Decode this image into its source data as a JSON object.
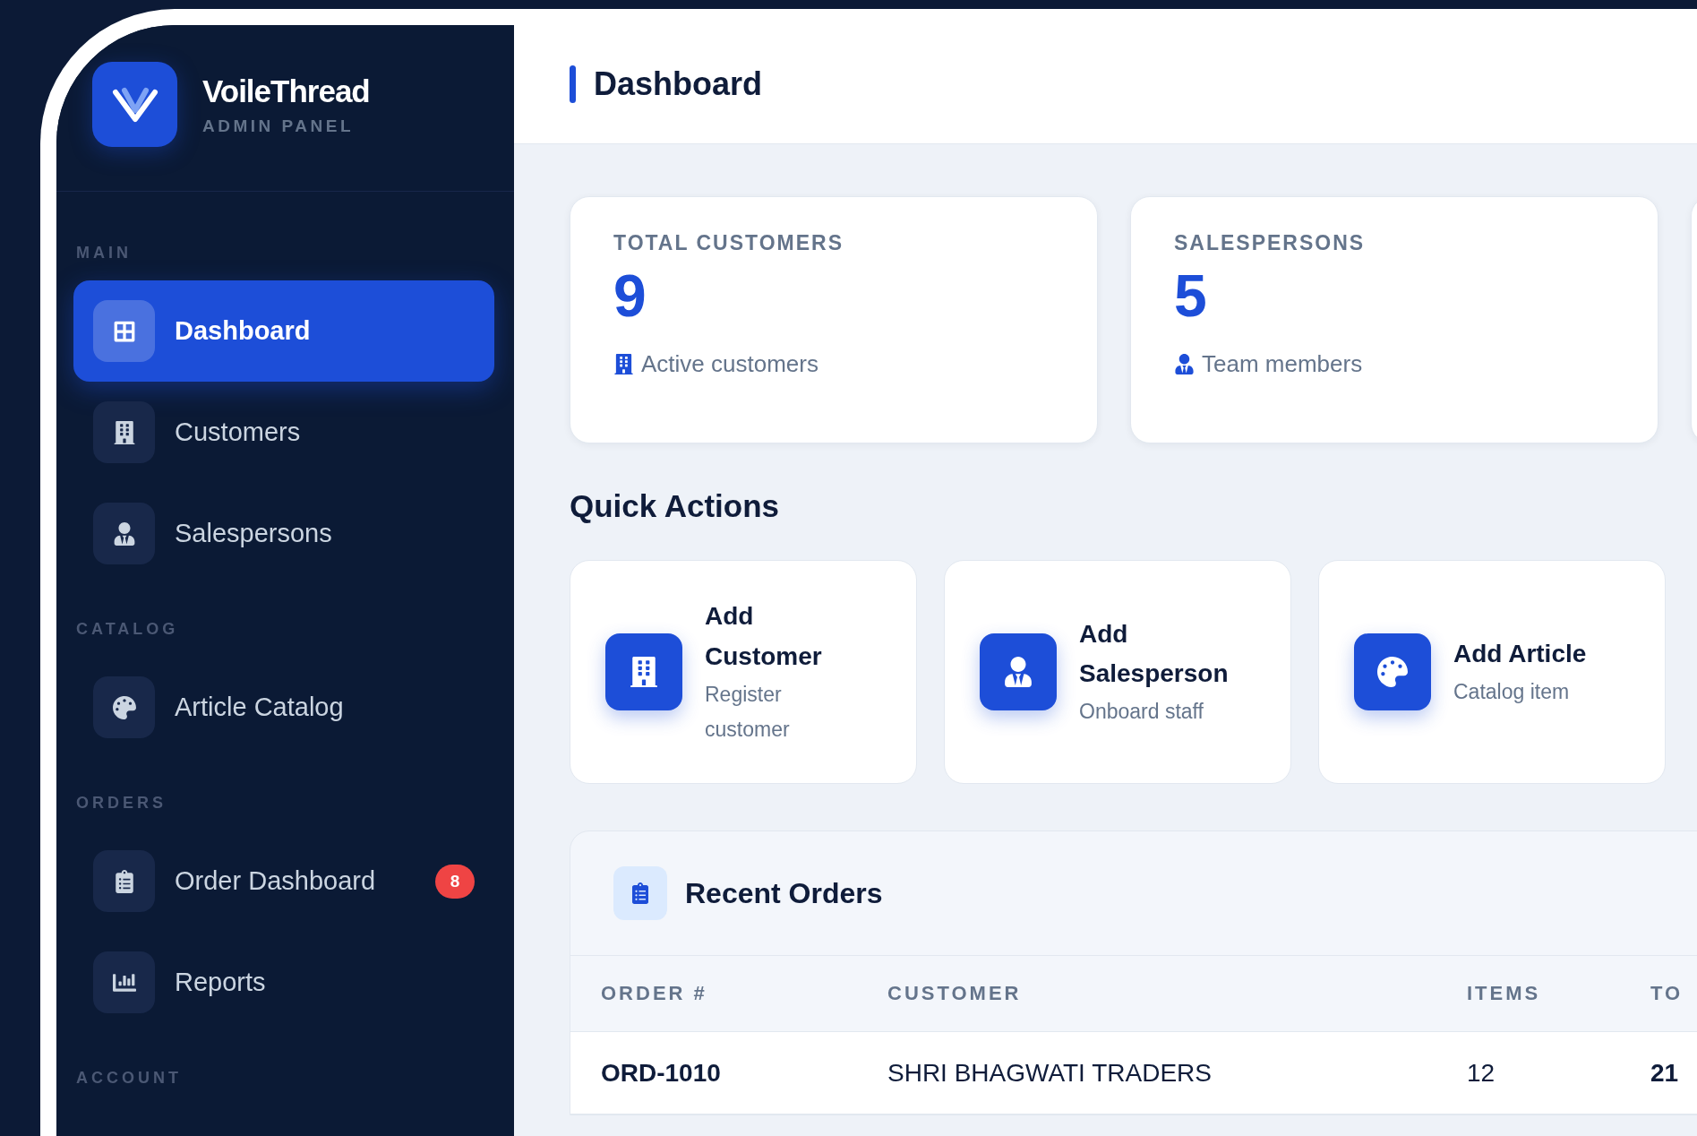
{
  "brand": {
    "name": "VoileThread",
    "subtitle": "ADMIN PANEL"
  },
  "sidebar": {
    "sections": [
      {
        "label": "MAIN",
        "items": [
          {
            "label": "Dashboard",
            "selected": true
          },
          {
            "label": "Customers",
            "selected": false
          },
          {
            "label": "Salespersons",
            "selected": false
          }
        ]
      },
      {
        "label": "CATALOG",
        "items": [
          {
            "label": "Article Catalog",
            "selected": false
          }
        ]
      },
      {
        "label": "ORDERS",
        "items": [
          {
            "label": "Order Dashboard",
            "selected": false,
            "badge": "8"
          },
          {
            "label": "Reports",
            "selected": false
          }
        ]
      },
      {
        "label": "ACCOUNT"
      }
    ]
  },
  "header": {
    "title": "Dashboard"
  },
  "stats": [
    {
      "label": "TOTAL CUSTOMERS",
      "value": "9",
      "note": "Active customers"
    },
    {
      "label": "SALESPERSONS",
      "value": "5",
      "note": "Team members"
    }
  ],
  "quick_actions": {
    "title": "Quick Actions",
    "items": [
      {
        "title": "Add Customer",
        "subtitle": "Register customer"
      },
      {
        "title": "Add Salesperson",
        "subtitle": "Onboard staff"
      },
      {
        "title": "Add Article",
        "subtitle": "Catalog item"
      }
    ]
  },
  "recent_orders": {
    "title": "Recent Orders",
    "columns": [
      "ORDER #",
      "CUSTOMER",
      "ITEMS",
      "TO"
    ],
    "rows": [
      {
        "order": "ORD-1010",
        "customer": "SHRI BHAGWATI TRADERS",
        "items": "12",
        "column_4": "21"
      }
    ]
  }
}
